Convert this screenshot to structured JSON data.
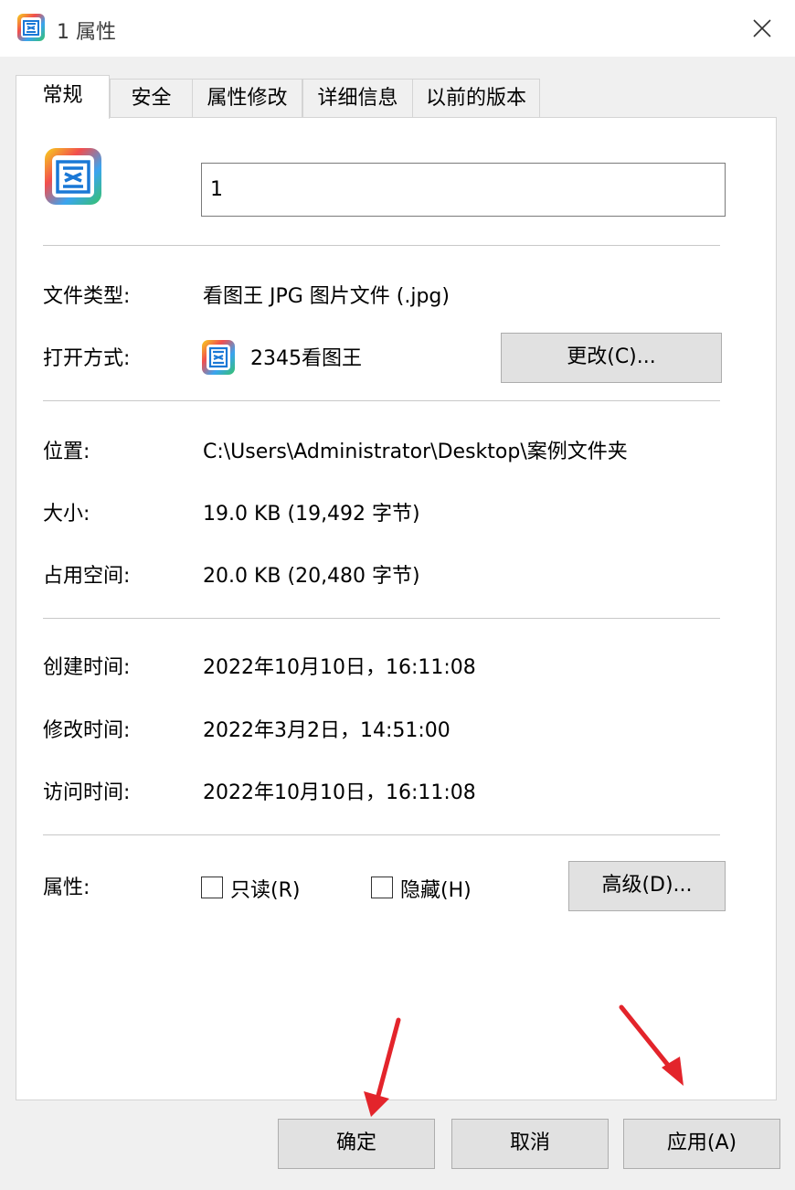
{
  "window": {
    "title": "1 属性",
    "icon": "image-viewer-app-icon",
    "close_icon": "close-icon"
  },
  "tabs": [
    {
      "label": "常规",
      "active": true
    },
    {
      "label": "安全",
      "active": false
    },
    {
      "label": "属性修改",
      "active": false
    },
    {
      "label": "详细信息",
      "active": false
    },
    {
      "label": "以前的版本",
      "active": false
    }
  ],
  "general": {
    "file_name": "1",
    "file_type_label": "文件类型:",
    "file_type_value": "看图王 JPG 图片文件 (.jpg)",
    "open_with_label": "打开方式:",
    "open_with_value": "2345看图王",
    "change_button": "更改(C)...",
    "location_label": "位置:",
    "location_value": "C:\\Users\\Administrator\\Desktop\\案例文件夹",
    "size_label": "大小:",
    "size_value": "19.0 KB (19,492 字节)",
    "disk_size_label": "占用空间:",
    "disk_size_value": "20.0 KB (20,480 字节)",
    "created_label": "创建时间:",
    "created_value": "2022年10月10日，16:11:08",
    "modified_label": "修改时间:",
    "modified_value": "2022年3月2日，14:51:00",
    "accessed_label": "访问时间:",
    "accessed_value": "2022年10月10日，16:11:08",
    "attributes_label": "属性:",
    "readonly_label": "只读(R)",
    "readonly_checked": false,
    "hidden_label": "隐藏(H)",
    "hidden_checked": false,
    "advanced_button": "高级(D)..."
  },
  "footer": {
    "ok_button": "确定",
    "cancel_button": "取消",
    "apply_button": "应用(A)"
  },
  "colors": {
    "annotation_arrow": "#e3242b",
    "window_bg": "#f0f0f0",
    "panel_bg": "#ffffff"
  }
}
